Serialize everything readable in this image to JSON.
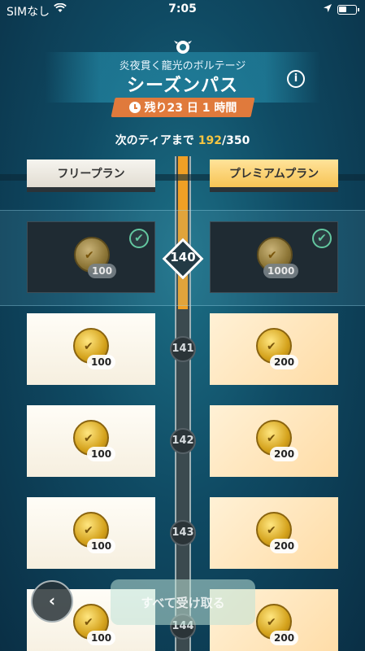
{
  "status_bar": {
    "carrier": "SIMなし",
    "time": "7:05"
  },
  "header": {
    "subtitle": "炎夜貫く龍光のボルテージ",
    "title": "シーズンパス",
    "info_glyph": "i",
    "time_remaining": "残り23 日 1 時間",
    "next_tier_label": "次のティアまで ",
    "next_tier_current": "192",
    "next_tier_total": "/350"
  },
  "plans": {
    "free_label": "フリープラン",
    "premium_label": "プレミアムプラン"
  },
  "tiers": [
    {
      "tier": "140",
      "free_amount": "100",
      "premium_amount": "1000",
      "claimed": true
    },
    {
      "tier": "141",
      "free_amount": "100",
      "premium_amount": "200",
      "claimed": false
    },
    {
      "tier": "142",
      "free_amount": "100",
      "premium_amount": "200",
      "claimed": false
    },
    {
      "tier": "143",
      "free_amount": "100",
      "premium_amount": "200",
      "claimed": false
    },
    {
      "tier": "144",
      "free_amount": "100",
      "premium_amount": "200",
      "claimed": false
    }
  ],
  "footer": {
    "back_glyph": "‹",
    "claim_all_label": "すべて受け取る"
  },
  "icons": [
    "wifi-icon",
    "location-arrow-icon",
    "battery-icon",
    "season-emblem-icon",
    "info-icon",
    "clock-icon",
    "gold-coin-icon",
    "check-icon",
    "back-arrow-icon"
  ],
  "colors": {
    "accent_orange": "#e07a3c",
    "progress_gold": "#f5c542",
    "claimed_check": "#63c7a0"
  }
}
